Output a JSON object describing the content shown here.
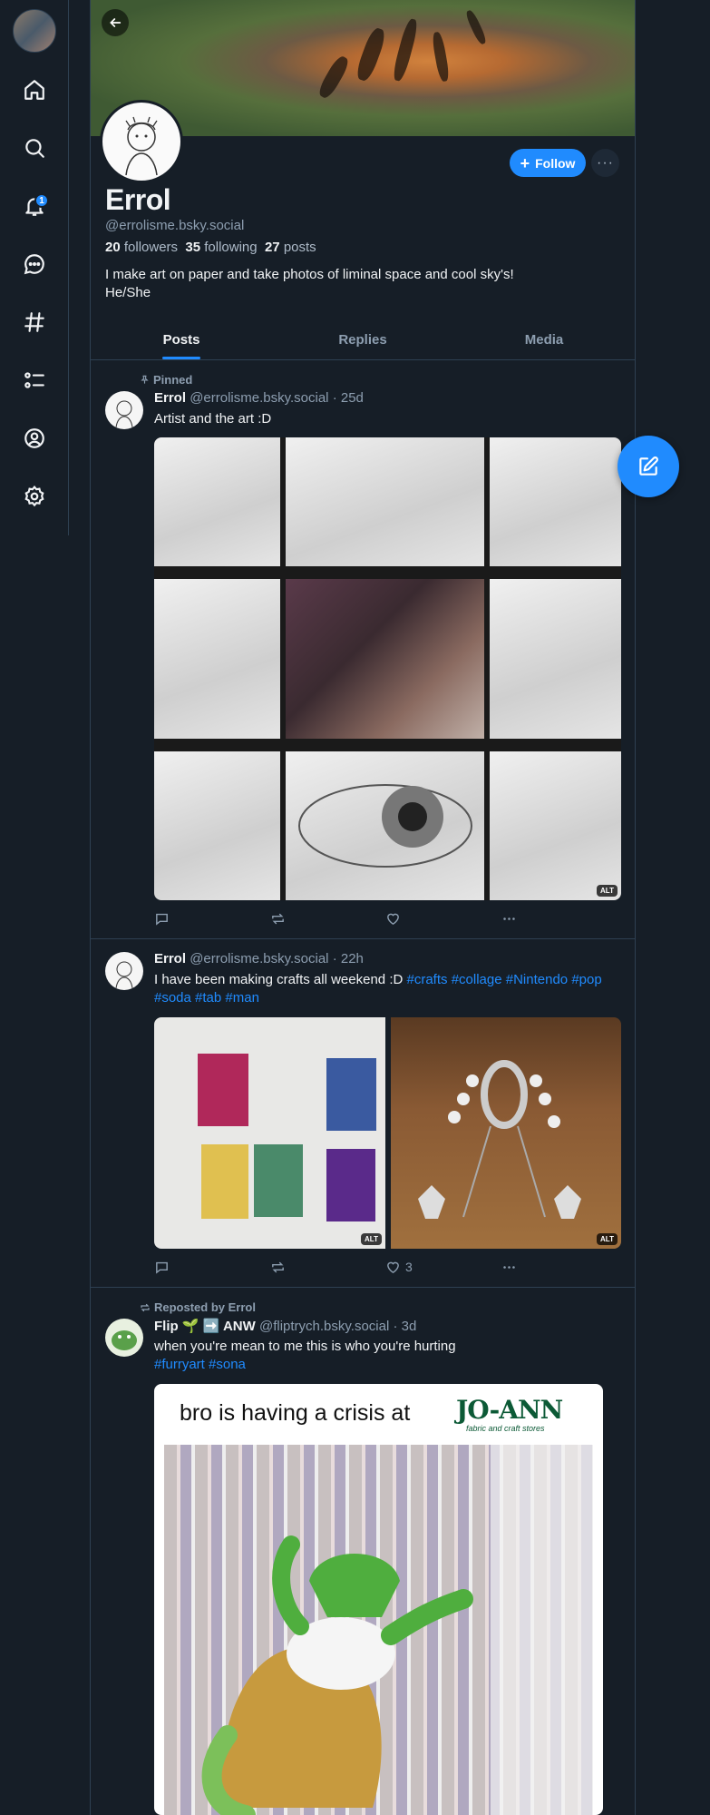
{
  "nav": {
    "notifications_count": "1"
  },
  "profile": {
    "display_name": "Errol",
    "handle": "@errolisme.bsky.social",
    "followers_count": "20",
    "followers_label": "followers",
    "following_count": "35",
    "following_label": "following",
    "posts_count": "27",
    "posts_label": "posts",
    "bio": "I make art on paper and take photos of liminal space and cool sky's!\nHe/She",
    "follow_label": "Follow",
    "more_label": "···"
  },
  "tabs": [
    {
      "label": "Posts",
      "active": true
    },
    {
      "label": "Replies",
      "active": false
    },
    {
      "label": "Media",
      "active": false
    }
  ],
  "posts": [
    {
      "context": "Pinned",
      "author_name": "Errol",
      "author_handle": "@errolisme.bsky.social",
      "time": "· 25d",
      "text": "Artist and the art :D",
      "images": 9,
      "alt_badge": "ALT",
      "like_count": ""
    },
    {
      "author_name": "Errol",
      "author_handle": "@errolisme.bsky.social",
      "time": "· 22h",
      "text": "I have been making crafts all weekend :D",
      "tags": [
        "#crafts",
        "#collage",
        "#Nintendo",
        "#pop",
        "#soda",
        "#tab",
        "#man"
      ],
      "images": 2,
      "alt_badge": "ALT",
      "like_count": "3"
    },
    {
      "context": "Reposted by Errol",
      "author_name": "Flip 🌱 ➡️ ANW",
      "author_handle": "@fliptrych.bsky.social",
      "time": "· 3d",
      "text": "when you're mean to me this is who you're hurting",
      "tags": [
        "#furryart",
        "#sona"
      ],
      "meme_caption": "bro is having a crisis at",
      "meme_logo": "JO-ANN",
      "meme_logo_sub": "fabric and craft stores"
    }
  ],
  "colors": {
    "background": "#161e27",
    "accent": "#208bfe",
    "border": "#2e4052",
    "muted_text": "#8d9eb0"
  }
}
